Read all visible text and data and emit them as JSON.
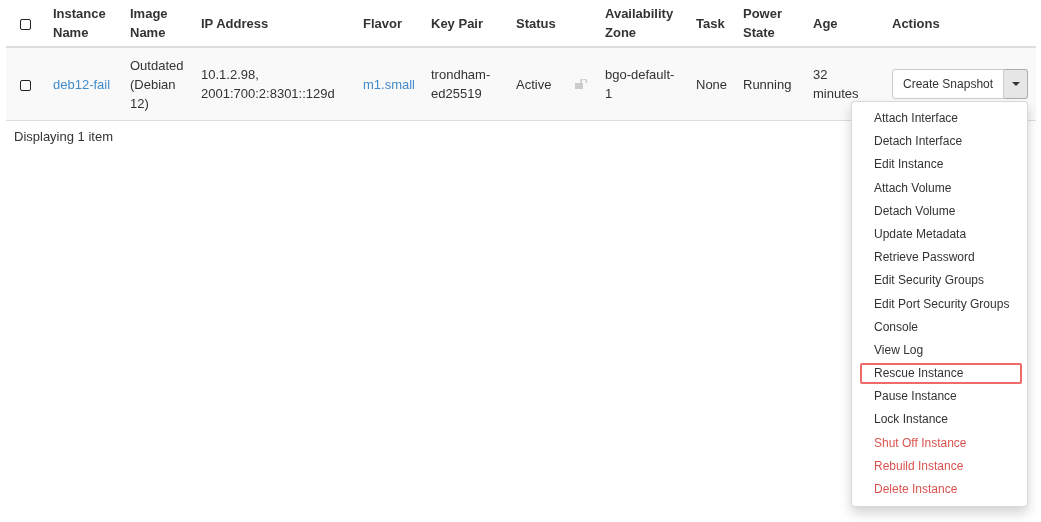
{
  "table": {
    "columns": [
      {
        "label": "Instance Name"
      },
      {
        "label": "Image Name"
      },
      {
        "label": "IP Address"
      },
      {
        "label": "Flavor"
      },
      {
        "label": "Key Pair"
      },
      {
        "label": "Status"
      },
      {
        "label": "Availability Zone"
      },
      {
        "label": "Task"
      },
      {
        "label": "Power State"
      },
      {
        "label": "Age"
      },
      {
        "label": "Actions"
      }
    ],
    "rows": [
      {
        "checked": false,
        "name": "deb12-fail",
        "image": "Outdated (Debian 12)",
        "ip": "10.1.2.98, 2001:700:2:8301::129d",
        "flavor": "m1.small",
        "key_pair": "trondham-ed25519",
        "status": "Active",
        "locked": false,
        "zone": "bgo-default-1",
        "task": "None",
        "power_state": "Running",
        "age": "32 minutes",
        "action": "Create Snapshot"
      }
    ]
  },
  "header_checkbox": {
    "checked": false
  },
  "footer": "Displaying 1 item",
  "menu": {
    "items": [
      {
        "label": "Attach Interface",
        "kind": "normal",
        "highlighted": false
      },
      {
        "label": "Detach Interface",
        "kind": "normal",
        "highlighted": false
      },
      {
        "label": "Edit Instance",
        "kind": "normal",
        "highlighted": false
      },
      {
        "label": "Attach Volume",
        "kind": "normal",
        "highlighted": false
      },
      {
        "label": "Detach Volume",
        "kind": "normal",
        "highlighted": false
      },
      {
        "label": "Update Metadata",
        "kind": "normal",
        "highlighted": false
      },
      {
        "label": "Retrieve Password",
        "kind": "normal",
        "highlighted": false
      },
      {
        "label": "Edit Security Groups",
        "kind": "normal",
        "highlighted": false
      },
      {
        "label": "Edit Port Security Groups",
        "kind": "normal",
        "highlighted": false
      },
      {
        "label": "Console",
        "kind": "normal",
        "highlighted": false
      },
      {
        "label": "View Log",
        "kind": "normal",
        "highlighted": false
      },
      {
        "label": "Rescue Instance",
        "kind": "normal",
        "highlighted": true
      },
      {
        "label": "Pause Instance",
        "kind": "normal",
        "highlighted": false
      },
      {
        "label": "Lock Instance",
        "kind": "normal",
        "highlighted": false
      },
      {
        "label": "Shut Off Instance",
        "kind": "danger",
        "highlighted": false
      },
      {
        "label": "Rebuild Instance",
        "kind": "danger",
        "highlighted": false
      },
      {
        "label": "Delete Instance",
        "kind": "danger",
        "highlighted": false
      }
    ]
  }
}
